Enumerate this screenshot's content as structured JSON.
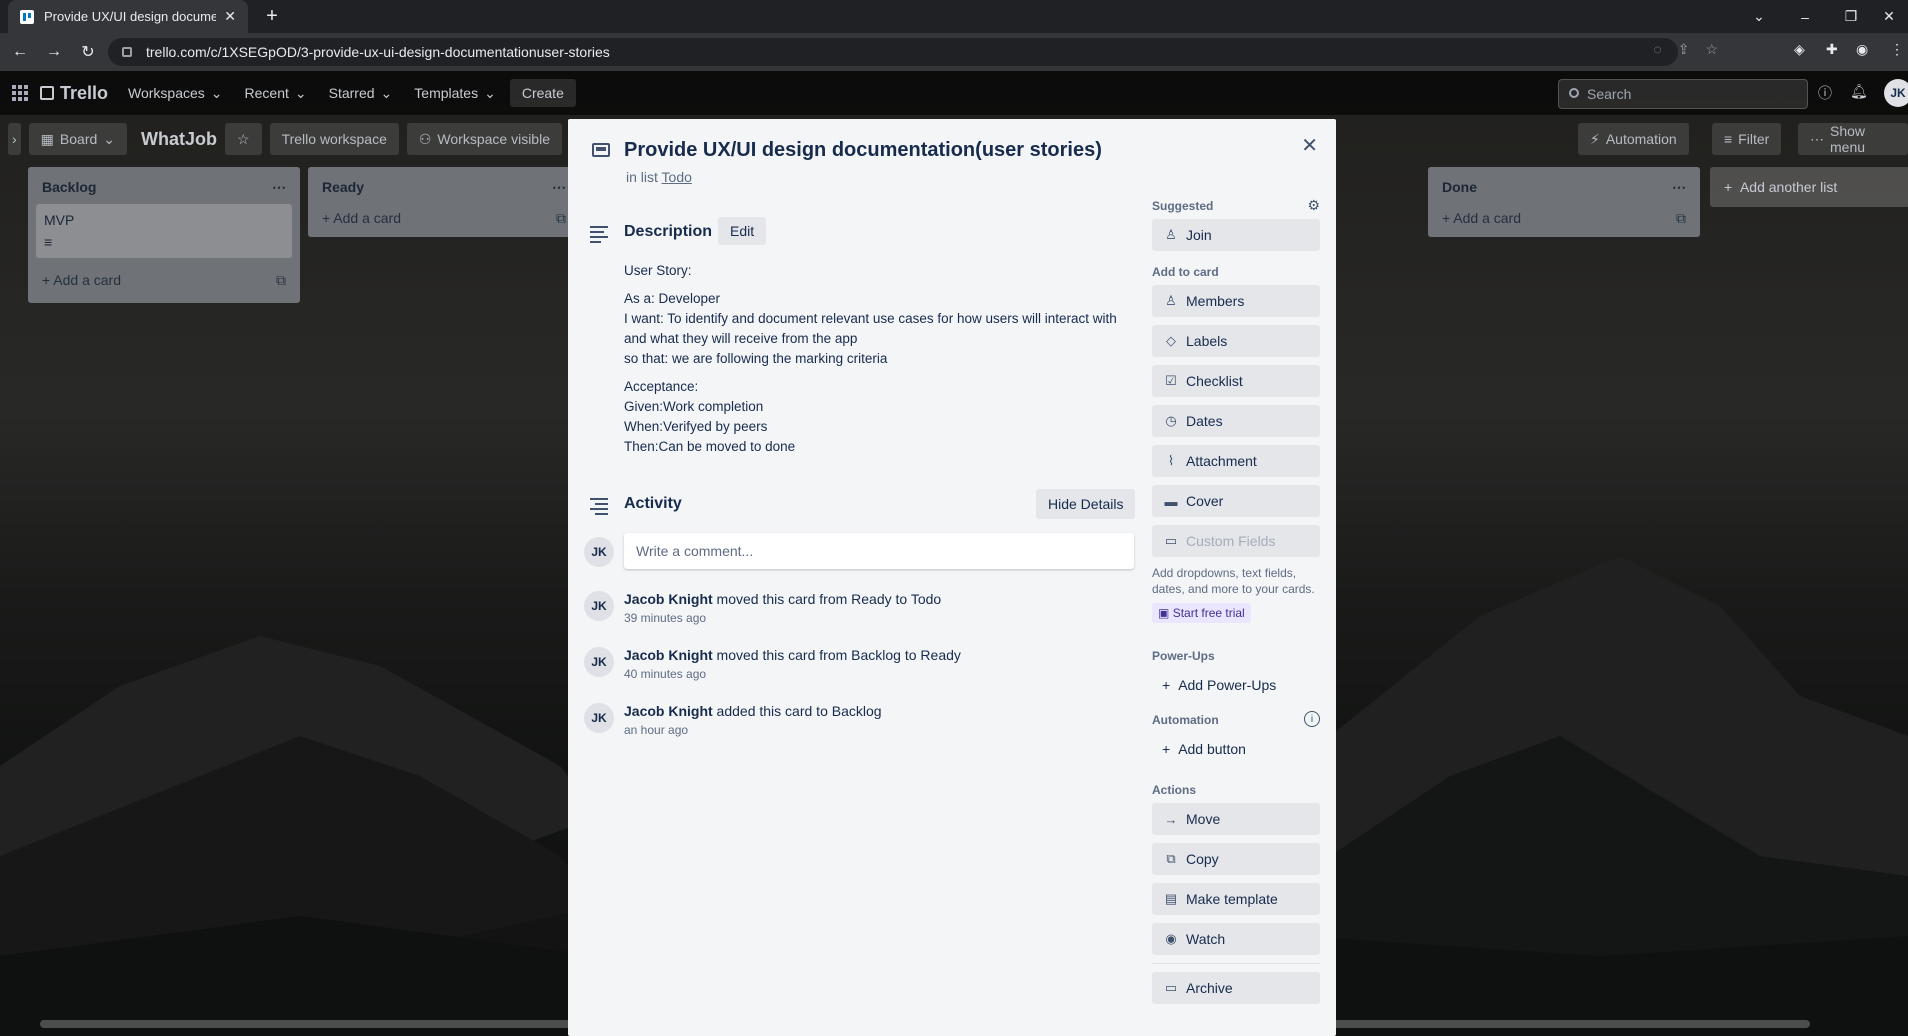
{
  "browser": {
    "tab_title": "Provide UX/UI design documentati",
    "url": "trello.com/c/1XSEGpOD/3-provide-ux-ui-design-documentationuser-stories"
  },
  "header": {
    "logo": "Trello",
    "nav": [
      "Workspaces",
      "Recent",
      "Starred",
      "Templates"
    ],
    "create": "Create",
    "search_placeholder": "Search",
    "avatar": "JK"
  },
  "boardbar": {
    "view": "Board",
    "name": "WhatJob",
    "workspace": "Trello workspace",
    "visibility": "Workspace visible",
    "automation": "Automation",
    "filter": "Filter",
    "show_menu": "Show menu"
  },
  "lists": {
    "backlog": {
      "title": "Backlog",
      "card": "MVP",
      "add": "Add a card"
    },
    "ready": {
      "title": "Ready",
      "add": "Add a card"
    },
    "done": {
      "title": "Done",
      "add": "Add a card"
    },
    "add_list": "Add another list"
  },
  "card": {
    "title": "Provide UX/UI design documentation(user stories)",
    "in_list_prefix": "in list",
    "in_list": "Todo",
    "description_label": "Description",
    "edit": "Edit",
    "description": {
      "story_label": "User Story:",
      "as": "As a: Developer",
      "want": "I want: To identify and document relevant use cases for how users will interact with and what they will receive from the app",
      "so": "so that: we are following the marking criteria",
      "acceptance": "Acceptance:",
      "given": "Given:Work completion",
      "when": "When:Verifyed by peers",
      "then": "Then:Can be moved to done"
    },
    "activity_label": "Activity",
    "hide_details": "Hide Details",
    "comment_placeholder": "Write a comment...",
    "activity": [
      {
        "user": "Jacob Knight",
        "text": " moved this card from Ready to Todo",
        "time": "39 minutes ago"
      },
      {
        "user": "Jacob Knight",
        "text": " moved this card from Backlog to Ready",
        "time": "40 minutes ago"
      },
      {
        "user": "Jacob Knight",
        "text": " added this card to Backlog",
        "time": "an hour ago"
      }
    ],
    "initials": "JK"
  },
  "sidebar": {
    "suggested": "Suggested",
    "join": "Join",
    "add_to_card": "Add to card",
    "members": "Members",
    "labels": "Labels",
    "checklist": "Checklist",
    "dates": "Dates",
    "attachment": "Attachment",
    "cover": "Cover",
    "custom_fields": "Custom Fields",
    "custom_fields_hint": "Add dropdowns, text fields, dates, and more to your cards.",
    "trial": "Start free trial",
    "powerups": "Power-Ups",
    "add_powerups": "Add Power-Ups",
    "automation": "Automation",
    "add_button": "Add button",
    "actions": "Actions",
    "move": "Move",
    "copy": "Copy",
    "make_template": "Make template",
    "watch": "Watch",
    "archive": "Archive"
  }
}
